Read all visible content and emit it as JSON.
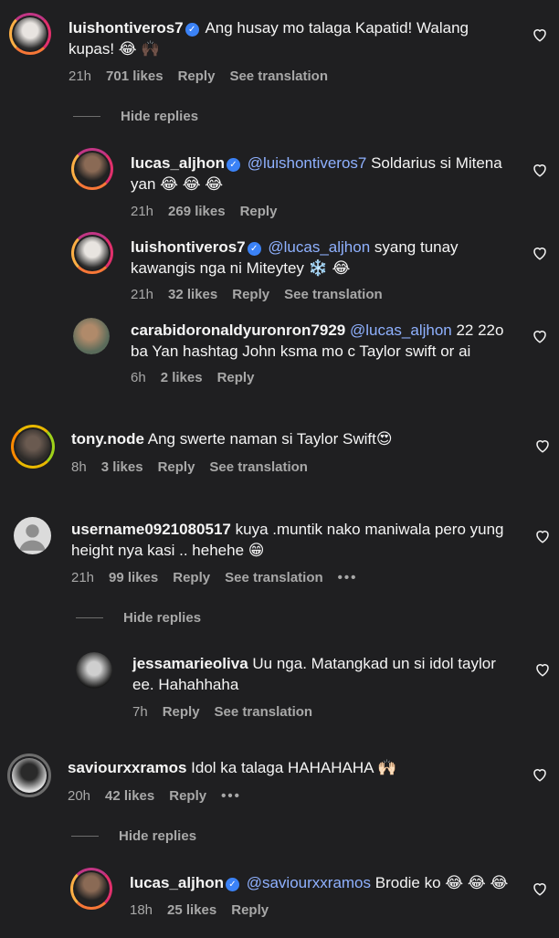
{
  "colors": {
    "background": "#1f1f21",
    "text": "#f5f5f5",
    "muted": "#a8a8a8",
    "mention": "#8fb1ff",
    "verified": "#3b82f6"
  },
  "icons": {
    "like": "heart-outline-icon",
    "verified": "verified-badge-icon",
    "more": "more-dots-icon"
  },
  "comments": [
    {
      "user": "luishontiveros7",
      "verified": true,
      "mention": "",
      "text": "Ang husay mo talaga Kapatid! Walang kupas! 😂 🙌🏿",
      "time": "21h",
      "likes": "701 likes",
      "reply": "Reply",
      "translate": "See translation"
    },
    {
      "user": "lucas_aljhon",
      "verified": true,
      "mention": "@luishontiveros7",
      "text": " Soldarius si Mitena yan 😂 😂 😂",
      "time": "21h",
      "likes": "269 likes",
      "reply": "Reply",
      "translate": ""
    },
    {
      "user": "luishontiveros7",
      "verified": true,
      "mention": "@lucas_aljhon",
      "text": " syang tunay kawangis nga ni Miteytey ❄️  😂",
      "time": "21h",
      "likes": "32 likes",
      "reply": "Reply",
      "translate": "See translation"
    },
    {
      "user": "carabidoronaldyuronron7929",
      "verified": false,
      "mention": "@lucas_aljhon",
      "text": " 22 22o ba Yan hashtag John ksma mo c Taylor swift or ai",
      "time": "6h",
      "likes": "2 likes",
      "reply": "Reply",
      "translate": ""
    },
    {
      "user": "tony.node",
      "verified": false,
      "mention": "",
      "text": "Ang swerte naman si Taylor Swift😍",
      "time": "8h",
      "likes": "3 likes",
      "reply": "Reply",
      "translate": "See translation"
    },
    {
      "user": "username0921080517",
      "verified": false,
      "mention": "",
      "text": "kuya .muntik nako maniwala pero yung height nya kasi .. hehehe 😁",
      "time": "21h",
      "likes": "99 likes",
      "reply": "Reply",
      "translate": "See translation",
      "more": "•••"
    },
    {
      "user": "jessamarieoliva",
      "verified": false,
      "mention": "",
      "text": "Uu nga. Matangkad un si idol taylor ee. Hahahhaha",
      "time": "7h",
      "likes": "",
      "reply": "Reply",
      "translate": "See translation"
    },
    {
      "user": "saviourxxramos",
      "verified": false,
      "mention": "",
      "text": "Idol ka talaga HAHAHAHA 🙌🏻",
      "time": "20h",
      "likes": "42 likes",
      "reply": "Reply",
      "translate": "",
      "more": "•••"
    },
    {
      "user": "lucas_aljhon",
      "verified": true,
      "mention": "@saviourxxramos",
      "text": " Brodie ko 😂 😂 😂",
      "time": "18h",
      "likes": "25 likes",
      "reply": "Reply",
      "translate": ""
    }
  ],
  "hide_replies": [
    "Hide replies",
    "Hide replies",
    "Hide replies"
  ]
}
